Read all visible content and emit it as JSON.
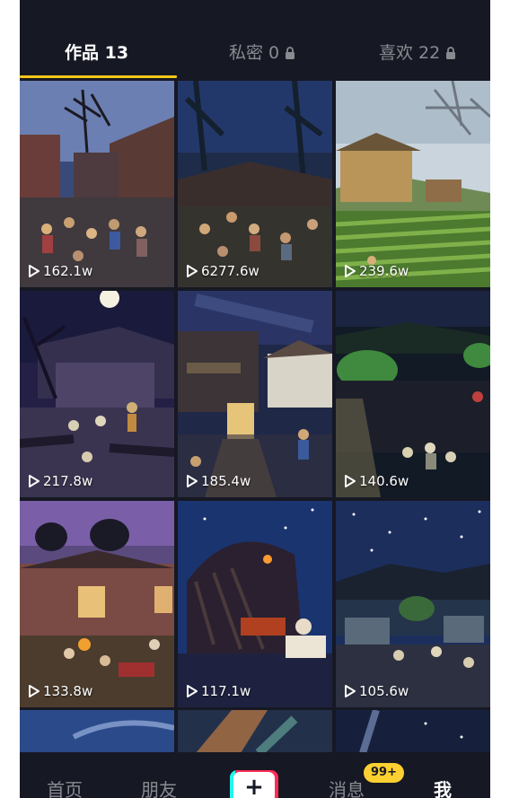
{
  "tabs": [
    {
      "label": "作品 13",
      "locked": false
    },
    {
      "label": "私密 0",
      "locked": true
    },
    {
      "label": "喜欢 22",
      "locked": true
    }
  ],
  "colors": {
    "background": "#161823",
    "active_underline": "#f5c518",
    "badge": "#fcd030",
    "add_button_cyan": "#25f4ee",
    "add_button_red": "#fe2c55"
  },
  "videos": [
    {
      "views": "162.1w"
    },
    {
      "views": "6277.6w"
    },
    {
      "views": "239.6w"
    },
    {
      "views": "217.8w"
    },
    {
      "views": "185.4w"
    },
    {
      "views": "140.6w"
    },
    {
      "views": "133.8w"
    },
    {
      "views": "117.1w"
    },
    {
      "views": "105.6w"
    }
  ],
  "icons": {
    "play": "play-icon",
    "lock": "lock-icon"
  },
  "bottom_nav": {
    "home": "首页",
    "friends": "朋友",
    "add": "+",
    "messages": "消息",
    "messages_badge": "99+",
    "me": "我"
  }
}
